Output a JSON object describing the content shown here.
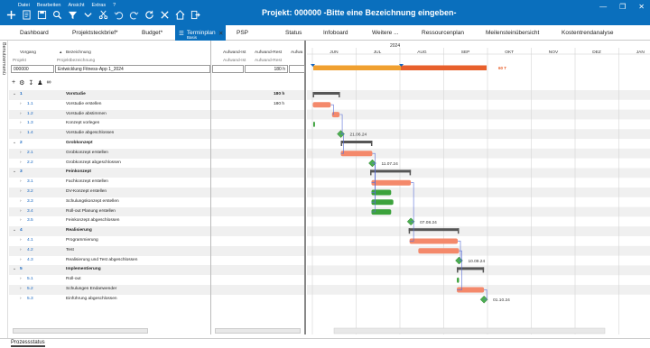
{
  "menu": [
    "Datei",
    "Bearbeiten",
    "Ansicht",
    "Extras",
    "?"
  ],
  "window": {
    "title": "Projekt: 000000 -Bitte eine Bezeichnung eingeben-"
  },
  "toolbar_icons": [
    "add-icon",
    "new-document-icon",
    "save-icon",
    "search-icon",
    "filter-icon",
    "dropdown-icon",
    "cut-icon",
    "undo-icon",
    "redo-icon",
    "refresh-icon",
    "tools-icon",
    "home-icon",
    "exit-icon"
  ],
  "tabs": [
    {
      "label": "Dashboard"
    },
    {
      "label": "Projektsteckbrief*"
    },
    {
      "label": "Budget*"
    },
    {
      "label": "Terminplan",
      "sub": "Basis",
      "active": true
    },
    {
      "label": "PSP"
    },
    {
      "label": "Status"
    },
    {
      "label": "Infoboard"
    },
    {
      "label": "Weitere ..."
    },
    {
      "label": "Ressourcenplan"
    },
    {
      "label": "Meilensteinübersicht"
    },
    {
      "label": "Kostentrendanalyse"
    }
  ],
  "sidebar_label": "Benutzermenü",
  "columns": {
    "vorgang": "Vorgang",
    "bezeichnung": "Bezeichnung",
    "projekt": "Projekt",
    "projektbezeichnung": "Projektbezeichnung",
    "aufwand_ist": "Aufwand-Ist",
    "aufwand_rest": "Aufwand-Rest",
    "aufwand": "Aufwa"
  },
  "project": {
    "id": "000000",
    "name": "Entwicklung Fitness-App 1_2024",
    "hours": "180 h"
  },
  "timeline": {
    "year": "2024",
    "months": [
      "JUN",
      "JUL",
      "AUG",
      "SEP",
      "OKT",
      "NOV",
      "DEZ",
      "JAN"
    ],
    "project_bar_label": "60 T"
  },
  "colors": {
    "accent": "#0a6fbd",
    "task": "#f4896b",
    "summary": "#555555",
    "done": "#3ca23c",
    "milestone": "#4caf50",
    "project_bar": "#e8602c"
  },
  "rows": [
    {
      "num": "1",
      "name": "Vorstudie",
      "bold": true,
      "rest": "180 h"
    },
    {
      "num": "1.1",
      "name": "Vorstudie erstellen",
      "rest": "180 h"
    },
    {
      "num": "1.2",
      "name": "Vorstudie abstimmen"
    },
    {
      "num": "1.3",
      "name": "Konzept vorlegen"
    },
    {
      "num": "1.4",
      "name": "Vorstudie abgeschlossen",
      "milestone": "21.06.24"
    },
    {
      "num": "2",
      "name": "Grobkonzept",
      "bold": true
    },
    {
      "num": "2.1",
      "name": "Grobkonzept erstellen"
    },
    {
      "num": "2.2",
      "name": "Grobkonzept abgeschlossen",
      "milestone": "11.07.24"
    },
    {
      "num": "3",
      "name": "Feinkonzept",
      "bold": true
    },
    {
      "num": "3.1",
      "name": "Fachkonzept erstellen"
    },
    {
      "num": "3.2",
      "name": "DV-Konzept erstellen"
    },
    {
      "num": "3.3",
      "name": "Schulungskonzept erstellen"
    },
    {
      "num": "3.4",
      "name": "Roll-out Planung erstellen"
    },
    {
      "num": "3.5",
      "name": "Feinkonzept abgeschlossen",
      "milestone": "07.08.24"
    },
    {
      "num": "4",
      "name": "Realisierung",
      "bold": true
    },
    {
      "num": "4.1",
      "name": "Programmierung"
    },
    {
      "num": "4.2",
      "name": "Test"
    },
    {
      "num": "4.3",
      "name": "Realisierung und Test abgeschlossen",
      "milestone": "10.09.24"
    },
    {
      "num": "5",
      "name": "Implementierung",
      "bold": true
    },
    {
      "num": "5.1",
      "name": "Roll-out"
    },
    {
      "num": "5.2",
      "name": "Schulungen Endanwender"
    },
    {
      "num": "5.3",
      "name": "Einführung abgeschlossen",
      "milestone": "01.10.24"
    }
  ],
  "status_tab": "Prozessstatus"
}
